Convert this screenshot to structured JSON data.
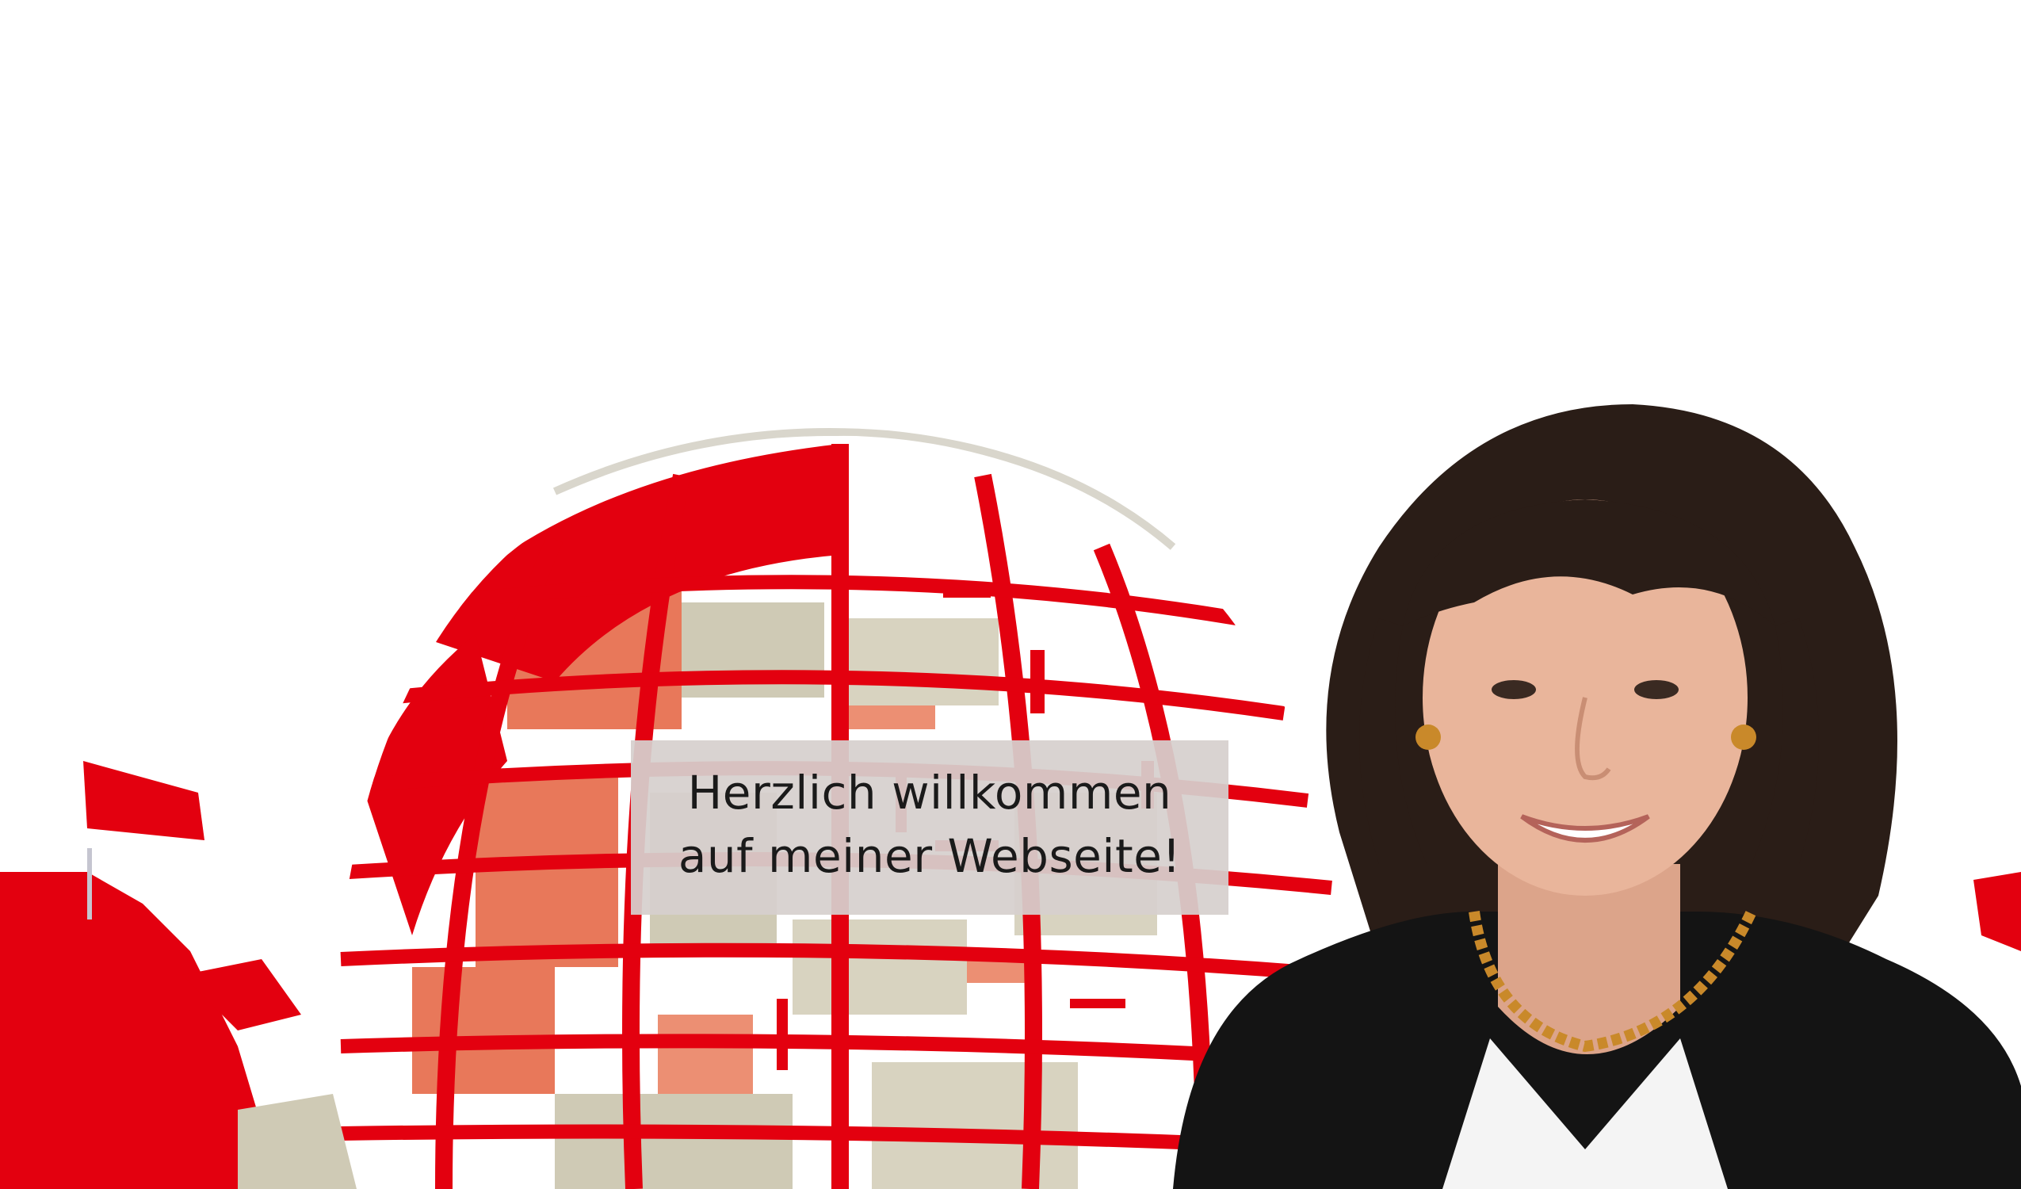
{
  "welcome": {
    "line1": "Herzlich willkommen",
    "line2": "auf meiner Webseite!"
  },
  "colors": {
    "background": "#ffffff",
    "brand_red": "#e3000f",
    "salmon": "#e8785a",
    "beige": "#cfcab5",
    "box_background": "#d6d0ce",
    "text": "#1a1a1a",
    "hair": "#2a1d17",
    "jacket": "#141414",
    "skin": "#e9b59b",
    "necklace": "#c9892a"
  },
  "images": {
    "background": "reichstag-dome-graphic",
    "portrait": "portrait-photo"
  }
}
